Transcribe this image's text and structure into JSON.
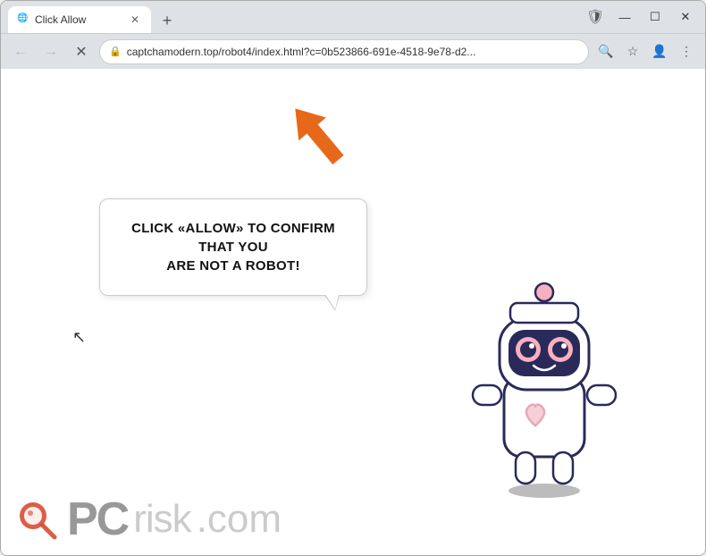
{
  "browser": {
    "tab": {
      "title": "Click Allow",
      "favicon": "🌐"
    },
    "new_tab_label": "+",
    "window_controls": {
      "minimize": "—",
      "maximize": "☐",
      "close": "✕"
    },
    "nav": {
      "back": "←",
      "forward": "→",
      "reload": "✕"
    },
    "url": "captchamodern.top/robot4/index.html?c=0b523866-691e-4518-9e78-d2...",
    "lock_icon": "🔒",
    "addr_icons": {
      "search": "🔍",
      "star": "☆",
      "profile": "👤",
      "menu": "⋮"
    }
  },
  "page": {
    "bubble_line1": "CLICK «ALLOW» TO CONFIRM THAT YOU",
    "bubble_line2": "ARE NOT A ROBOT!",
    "watermark": {
      "brand": "PC",
      "brand_light": "risk",
      "domain": ".com"
    }
  }
}
